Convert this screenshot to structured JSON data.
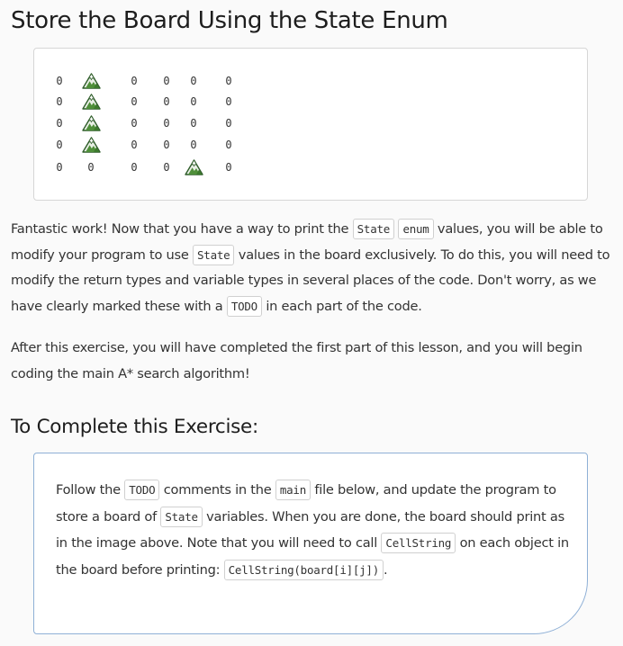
{
  "heading": "Store the Board Using the State Enum",
  "board": {
    "rows": [
      [
        "0",
        "mountain",
        "0",
        "0",
        "0",
        "0"
      ],
      [
        "0",
        "mountain",
        "0",
        "0",
        "0",
        "0"
      ],
      [
        "0",
        "mountain",
        "0",
        "0",
        "0",
        "0"
      ],
      [
        "0",
        "mountain",
        "0",
        "0",
        "0",
        "0"
      ],
      [
        "0",
        "0",
        "0",
        "0",
        "mountain",
        "0"
      ]
    ],
    "icon": "mountain-icon"
  },
  "paragraph1": {
    "t1": "Fantastic work! Now that you have a way to print the ",
    "c1": "State",
    "t2": " ",
    "c2": "enum",
    "t3": " values, you will be able to modify your program to use ",
    "c3": "State",
    "t4": " values in the board exclusively. To do this, you will need to modify the return types and variable types in several places of the code. Don't worry, as we have clearly marked these with a ",
    "c4": "TODO",
    "t5": " in each part of the code."
  },
  "paragraph2": "After this exercise, you will have completed the first part of this lesson, and you will begin coding the main A* search algorithm!",
  "subheading": "To Complete this Exercise:",
  "task": {
    "t1": "Follow the ",
    "c1": "TODO",
    "t2": " comments in the ",
    "c2": "main",
    "t3": " file below, and update the program to store a board of ",
    "c3": "State",
    "t4": " variables. When you are done, the board should print as in the image above. Note that you will need to call ",
    "c4": "CellString",
    "t5": " on each object in the board before printing: ",
    "c5": "CellString(board[i][j])",
    "t6": "."
  }
}
